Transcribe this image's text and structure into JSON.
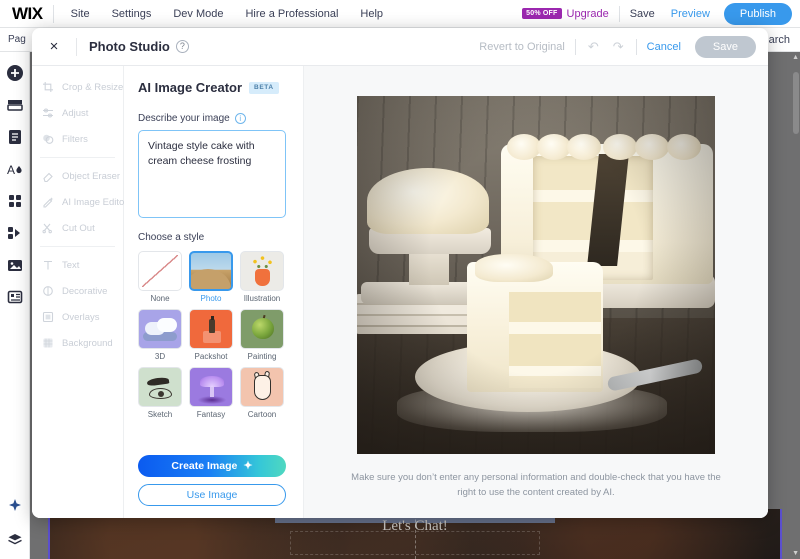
{
  "editor": {
    "logo": "WIX",
    "menu": [
      "Site",
      "Settings",
      "Dev Mode",
      "Hire a Professional",
      "Help"
    ],
    "promo_badge": "50% OFF",
    "upgrade": "Upgrade",
    "save": "Save",
    "preview": "Preview",
    "publish": "Publish",
    "pages_label": "Pag",
    "search_label": "arch",
    "rail_icons": [
      "add-icon",
      "layers-icon",
      "pages-icon",
      "theme-icon",
      "apps-icon",
      "media-manager-icon",
      "my-uploads-icon",
      "blog-icon"
    ],
    "rail_bottom_icons": [
      "ai-assistant-icon",
      "layers-stack-icon"
    ],
    "canvas_text": "Let's Chat!"
  },
  "modal": {
    "title": "Photo Studio",
    "close_label": "×",
    "help_label": "?",
    "revert_label": "Revert to Original",
    "undo_label": "↶",
    "redo_label": "↷",
    "cancel_label": "Cancel",
    "save_label": "Save"
  },
  "tools": {
    "groups": [
      [
        {
          "label": "Crop & Resize",
          "icon": "crop-icon"
        },
        {
          "label": "Adjust",
          "icon": "adjust-sliders-icon"
        },
        {
          "label": "Filters",
          "icon": "filters-icon"
        }
      ],
      [
        {
          "label": "Object Eraser",
          "icon": "object-eraser-icon"
        },
        {
          "label": "AI Image Editor",
          "icon": "ai-image-editor-icon"
        },
        {
          "label": "Cut Out",
          "icon": "cut-out-icon"
        }
      ],
      [
        {
          "label": "Text",
          "icon": "text-icon"
        },
        {
          "label": "Decorative",
          "icon": "decorative-icon"
        },
        {
          "label": "Overlays",
          "icon": "overlays-icon"
        },
        {
          "label": "Background",
          "icon": "background-icon"
        }
      ]
    ]
  },
  "ai_panel": {
    "title": "AI Image Creator",
    "badge": "BETA",
    "describe_label": "Describe your image",
    "info_label": "i",
    "prompt_value": "Vintage style cake with cream cheese frosting",
    "prompt_placeholder": "Describe your image",
    "choose_style_label": "Choose a style",
    "styles": [
      {
        "name": "None",
        "art": "t-none",
        "selected": false
      },
      {
        "name": "Photo",
        "art": "t-photo",
        "selected": true
      },
      {
        "name": "Illustration",
        "art": "t-illu",
        "selected": false
      },
      {
        "name": "3D",
        "art": "t-3d",
        "selected": false
      },
      {
        "name": "Packshot",
        "art": "t-pack",
        "selected": false
      },
      {
        "name": "Painting",
        "art": "t-paint",
        "selected": false
      },
      {
        "name": "Sketch",
        "art": "t-sketch",
        "selected": false
      },
      {
        "name": "Fantasy",
        "art": "t-fant",
        "selected": false
      },
      {
        "name": "Cartoon",
        "art": "t-cart",
        "selected": false
      }
    ],
    "create_label": "Create Image",
    "create_icon": "✦",
    "use_label": "Use Image"
  },
  "preview": {
    "image_alt": "vintage-style-layer-cake-with-cream-cheese-frosting",
    "disclaimer": "Make sure you don’t enter any personal information and double-check that you have the right to use the content created by AI."
  },
  "colors": {
    "accent_blue": "#3899ec",
    "promo_purple": "#9b27af",
    "text_dark": "#2b2e3f",
    "panel_bg": "#f7f8f9",
    "disabled_gray": "#bfc7d0"
  }
}
